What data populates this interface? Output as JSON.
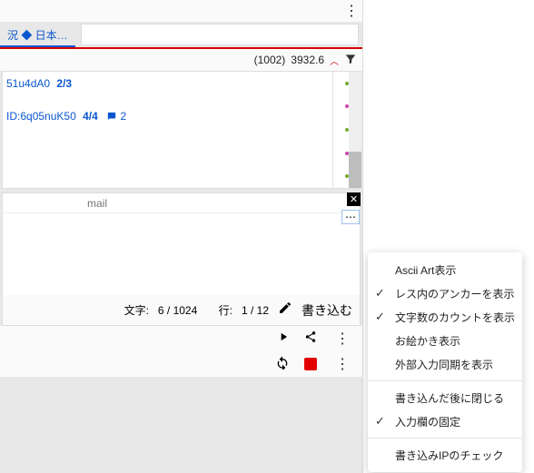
{
  "topbar": {},
  "tab": {
    "label": "況 ◆ 日本…"
  },
  "stats": {
    "count": "(1002)",
    "speed": "3932.6"
  },
  "posts": [
    {
      "id_fragment": "51u4dA0",
      "ratio": "2/3",
      "replies": ""
    },
    {
      "id_prefix": "ID:",
      "id_fragment": "6q05nuK50",
      "ratio": "4/4",
      "reply_count": "2"
    }
  ],
  "compose": {
    "mail_placeholder": "mail",
    "char_label": "文字:",
    "char_value": "6 / 1024",
    "line_label": "行:",
    "line_value": "1 / 12",
    "submit": "書き込む"
  },
  "menu": {
    "items": [
      {
        "label": "Ascii Art表示",
        "checked": false
      },
      {
        "label": "レス内のアンカーを表示",
        "checked": true
      },
      {
        "label": "文字数のカウントを表示",
        "checked": true
      },
      {
        "label": "お絵かき表示",
        "checked": false
      },
      {
        "label": "外部入力同期を表示",
        "checked": false
      }
    ],
    "items2": [
      {
        "label": "書き込んだ後に閉じる",
        "checked": false
      },
      {
        "label": "入力欄の固定",
        "checked": true
      }
    ],
    "items3": [
      {
        "label": "書き込みIPのチェック",
        "checked": false
      }
    ]
  }
}
